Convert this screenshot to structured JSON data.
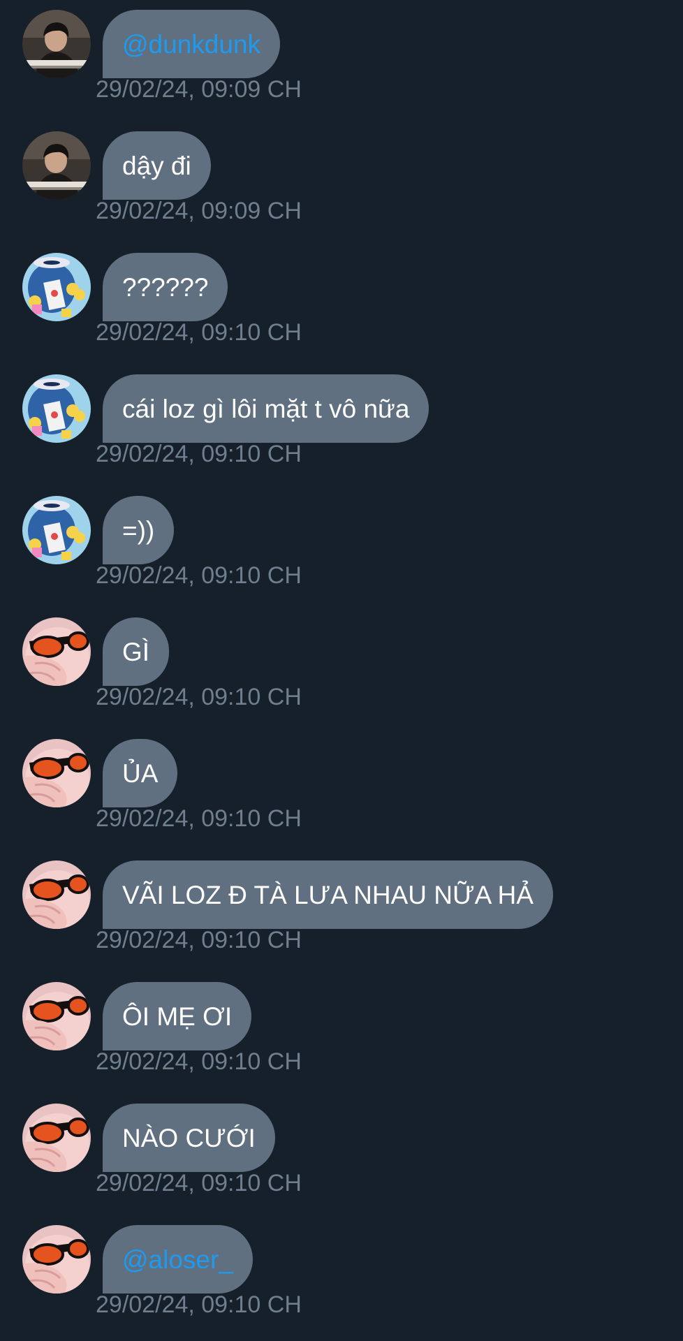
{
  "conversation": {
    "messages": [
      {
        "author": "photo",
        "text": "@dunkdunk",
        "time": "29/02/24, 09:09 CH",
        "mention": true
      },
      {
        "author": "photo",
        "text": "dậy đi",
        "time": "29/02/24, 09:09 CH",
        "mention": false
      },
      {
        "author": "cartoon",
        "text": "??????",
        "time": "29/02/24, 09:10 CH",
        "mention": false
      },
      {
        "author": "cartoon",
        "text": "cái loz gì lôi mặt t vô nữa",
        "time": "29/02/24, 09:10 CH",
        "mention": false
      },
      {
        "author": "cartoon",
        "text": "=))",
        "time": "29/02/24, 09:10 CH",
        "mention": false
      },
      {
        "author": "glasses",
        "text": "GÌ",
        "time": "29/02/24, 09:10 CH",
        "mention": false
      },
      {
        "author": "glasses",
        "text": "ỦA",
        "time": "29/02/24, 09:10 CH",
        "mention": false
      },
      {
        "author": "glasses",
        "text": "VÃI LOZ Đ TÀ LƯA NHAU NỮA HẢ",
        "time": "29/02/24, 09:10 CH",
        "mention": false
      },
      {
        "author": "glasses",
        "text": "ÔI MẸ ƠI",
        "time": "29/02/24, 09:10 CH",
        "mention": false
      },
      {
        "author": "glasses",
        "text": "NÀO CƯỚI",
        "time": "29/02/24, 09:10 CH",
        "mention": false
      },
      {
        "author": "glasses",
        "text": "@aloser_",
        "time": "29/02/24, 09:10 CH",
        "mention": true
      }
    ]
  },
  "colors": {
    "background": "#15202b",
    "bubble": "#607080",
    "message_text": "#ffffff",
    "mention_link": "#1d9bf0",
    "timestamp": "#6f7f8e"
  },
  "icons": {
    "photo": "person-photo-avatar",
    "cartoon": "cartoon-avatar",
    "glasses": "orange-sunglasses-avatar"
  }
}
